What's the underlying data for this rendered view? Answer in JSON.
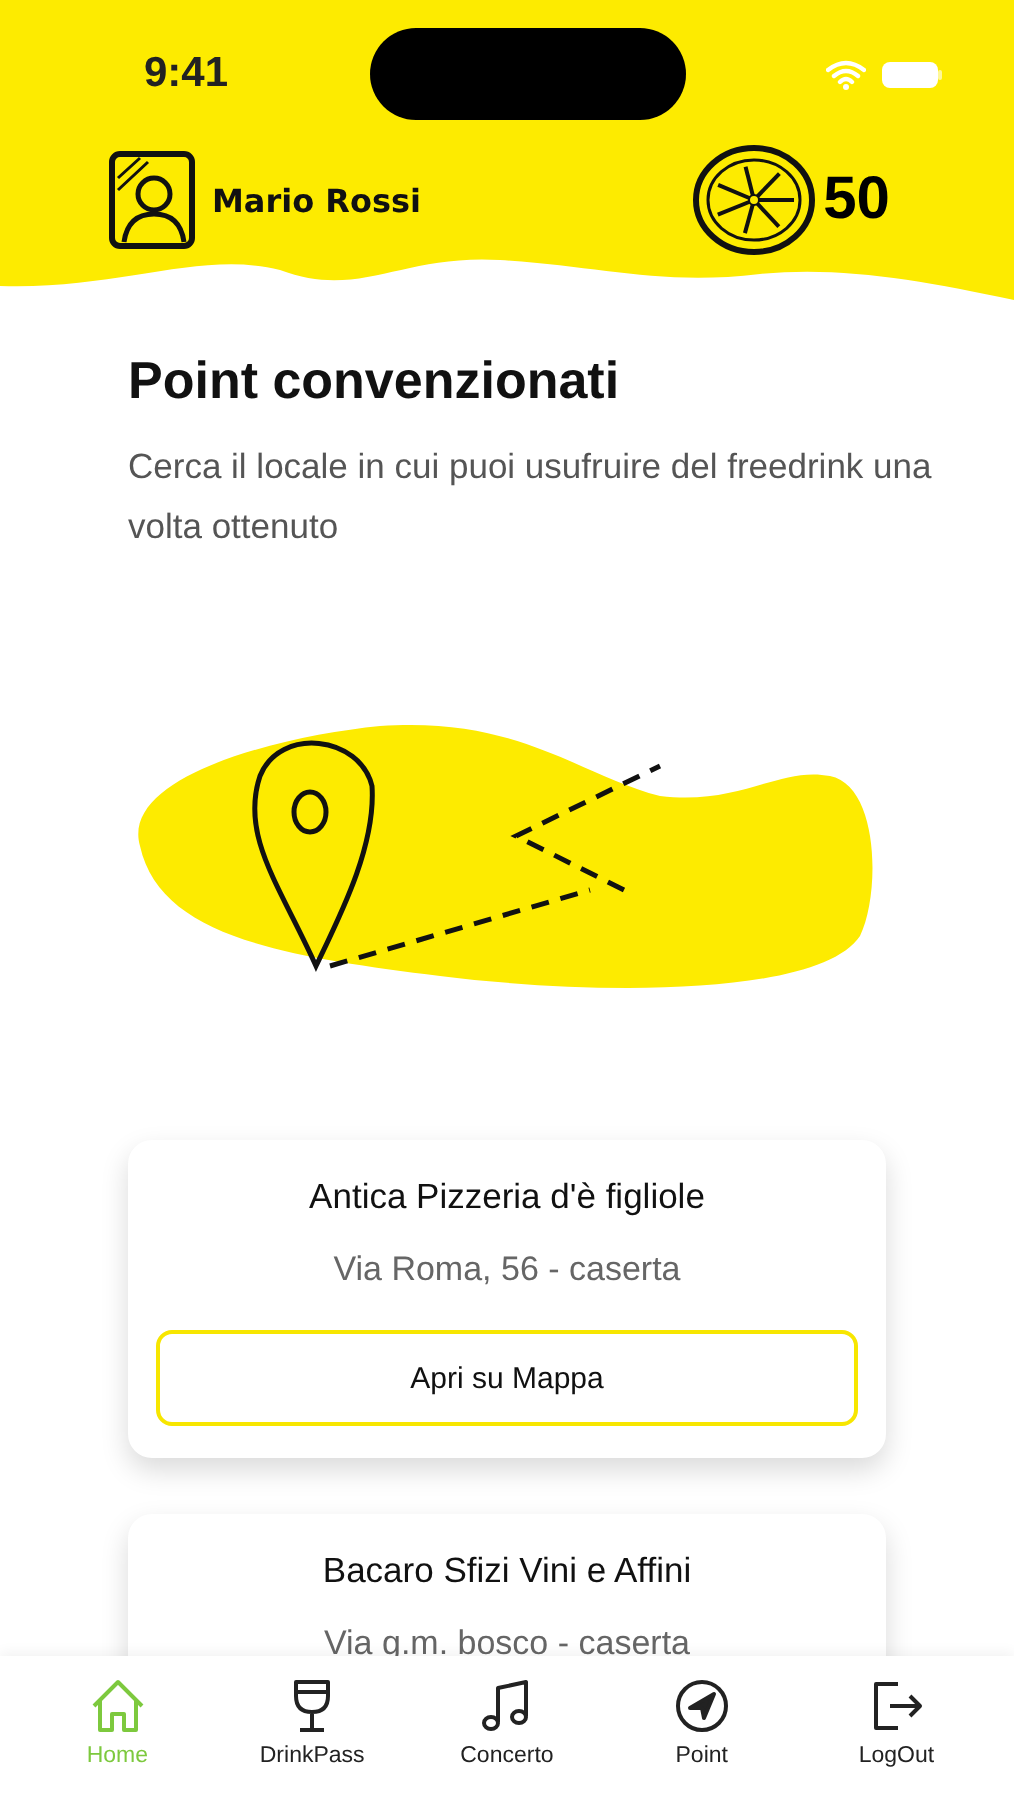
{
  "status_bar": {
    "time": "9:41"
  },
  "header": {
    "user_name": "Mario Rossi",
    "points": "50"
  },
  "title": "Point convenzionati",
  "subtitle": "Cerca il locale in cui puoi usufruire del freedrink una volta ottenuto",
  "places": [
    {
      "name": "Antica Pizzeria d'è figliole",
      "address": "Via Roma, 56 - caserta",
      "button": "Apri su Mappa"
    },
    {
      "name": "Bacaro Sfizi Vini e Affini",
      "address": "Via g.m. bosco - caserta"
    }
  ],
  "tabs": [
    {
      "kind": "home",
      "label": "Home",
      "selected": true
    },
    {
      "kind": "drink",
      "label": "DrinkPass",
      "selected": false
    },
    {
      "kind": "music",
      "label": "Concerto",
      "selected": false
    },
    {
      "kind": "point",
      "label": "Point",
      "selected": false
    },
    {
      "kind": "logout",
      "label": "LogOut",
      "selected": false
    }
  ]
}
